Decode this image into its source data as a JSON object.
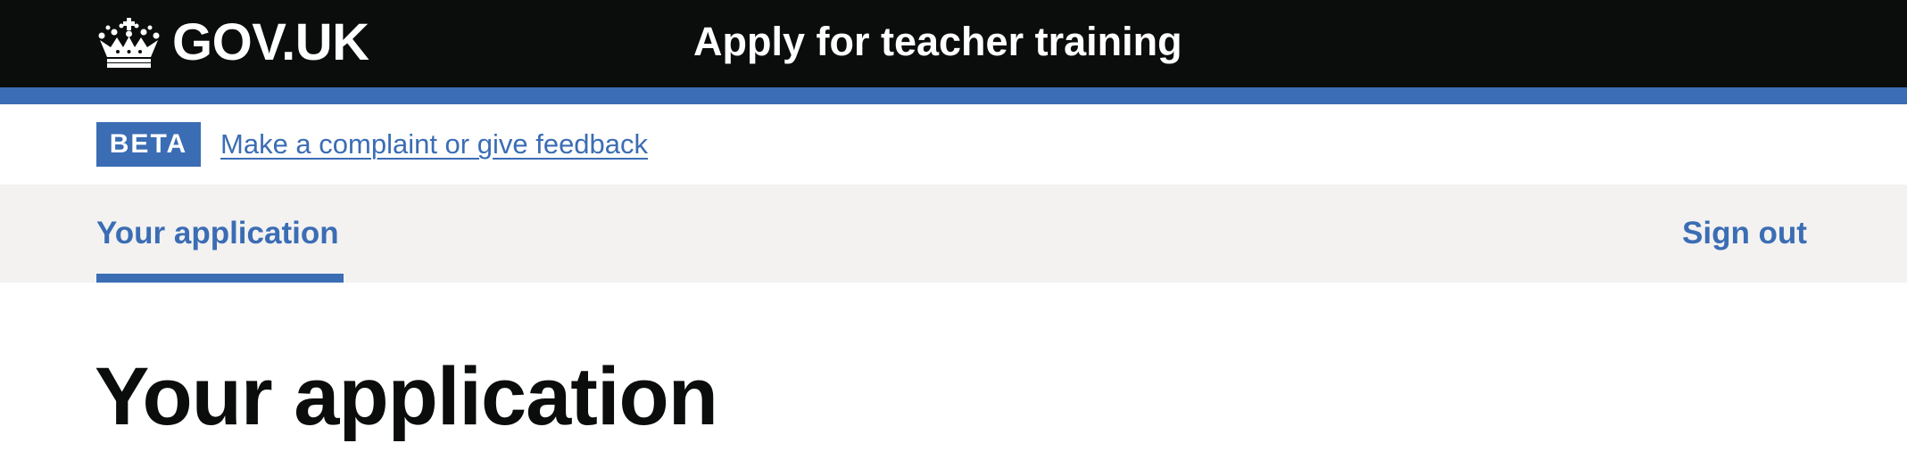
{
  "header": {
    "logo_text": "GOV.UK",
    "logo_icon": "crown-icon",
    "service_name": "Apply for teacher training"
  },
  "phase_banner": {
    "tag": "BETA",
    "link_text": "Make a complaint or give feedback"
  },
  "nav": {
    "items": [
      {
        "label": "Your application",
        "active": true
      },
      {
        "label": "Sign out",
        "active": false
      }
    ]
  },
  "main": {
    "title": "Your application"
  },
  "colors": {
    "header_bg": "#0b0c0c",
    "accent": "#3b6db4",
    "nav_bg": "#f3f2f1",
    "text": "#0b0c0c"
  }
}
